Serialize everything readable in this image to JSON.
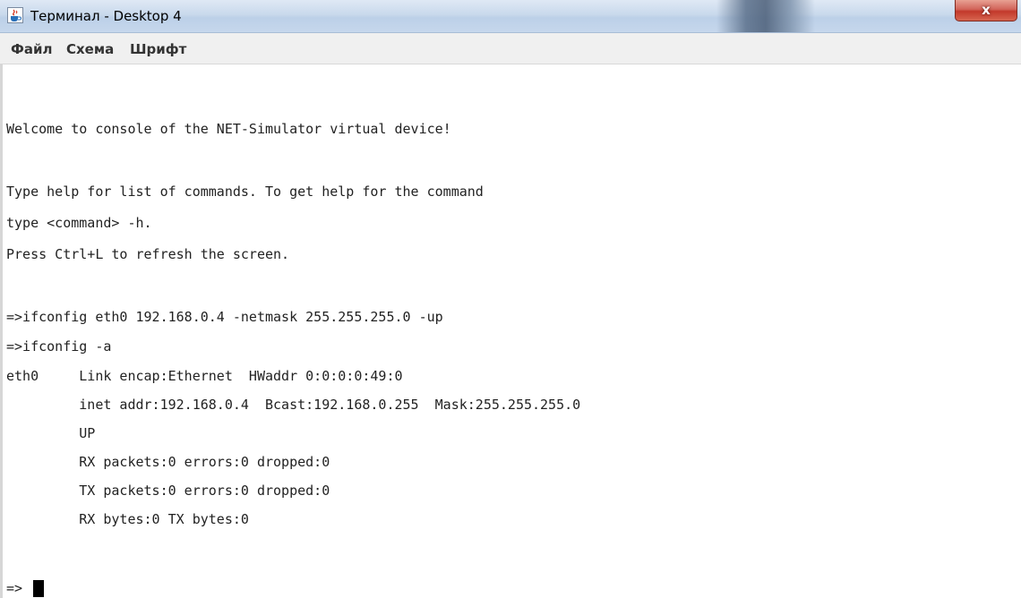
{
  "window": {
    "title": "Терминал - Desktop 4",
    "close_label": "x",
    "app_icon": "java-cup-icon"
  },
  "menu": {
    "items": [
      {
        "label": "Файл"
      },
      {
        "label": "Схема"
      },
      {
        "label": "Шрифт"
      }
    ]
  },
  "terminal": {
    "lines": [
      "Welcome to console of the NET-Simulator virtual device!",
      "",
      "Type help for list of commands. To get help for the command",
      "type <command> -h.",
      "Press Ctrl+L to refresh the screen.",
      "",
      "=>ifconfig eth0 192.168.0.4 -netmask 255.255.255.0 -up",
      "=>ifconfig -a",
      "eth0     Link encap:Ethernet  HWaddr 0:0:0:0:49:0",
      "         inet addr:192.168.0.4  Bcast:192.168.0.255  Mask:255.255.255.0",
      "         UP",
      "         RX packets:0 errors:0 dropped:0",
      "         TX packets:0 errors:0 dropped:0",
      "         RX bytes:0 TX bytes:0",
      "",
      "=>"
    ]
  },
  "colors": {
    "close_button": "#c3392b",
    "menubar": "#f0f0f0",
    "terminal_bg": "#ffffff",
    "terminal_text": "#222222"
  }
}
